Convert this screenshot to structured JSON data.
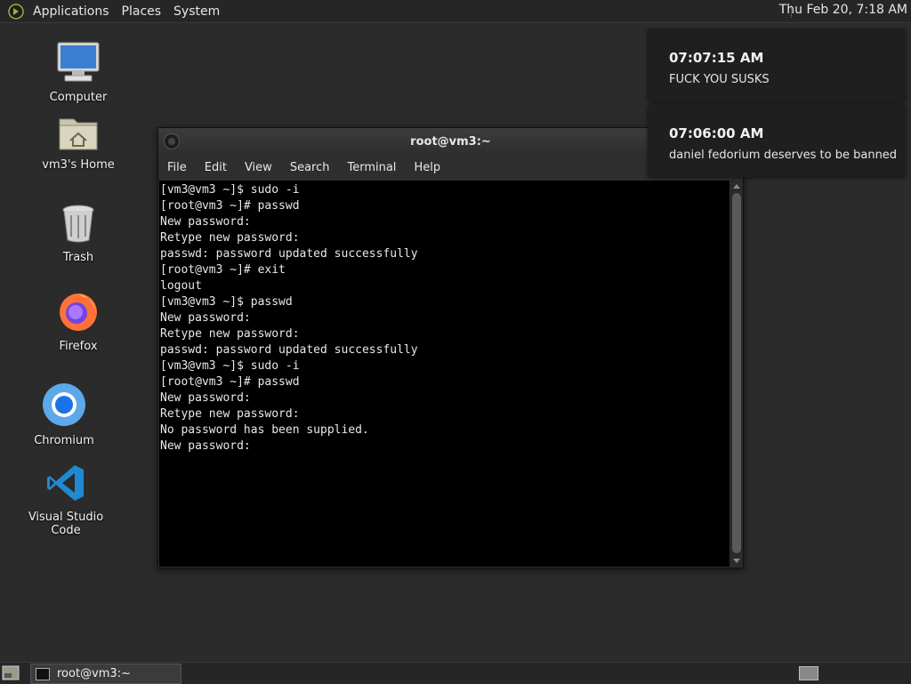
{
  "top_panel": {
    "menus": [
      "Applications",
      "Places",
      "System"
    ],
    "clock": "Thu Feb 20,  7:18 AM"
  },
  "desktop_icons": [
    {
      "label": "Computer",
      "icon": "computer-icon"
    },
    {
      "label": "vm3's Home",
      "icon": "home-folder-icon"
    },
    {
      "label": "Trash",
      "icon": "trash-icon"
    },
    {
      "label": "Firefox",
      "icon": "firefox-icon"
    },
    {
      "label": "Chromium",
      "icon": "chromium-icon"
    },
    {
      "label": "Visual Studio Code",
      "icon": "vscode-icon"
    }
  ],
  "terminal": {
    "title": "root@vm3:~",
    "menu": [
      "File",
      "Edit",
      "View",
      "Search",
      "Terminal",
      "Help"
    ],
    "lines": [
      "[vm3@vm3 ~]$ sudo -i",
      "[root@vm3 ~]# passwd",
      "New password:",
      "Retype new password:",
      "passwd: password updated successfully",
      "[root@vm3 ~]# exit",
      "logout",
      "[vm3@vm3 ~]$ passwd",
      "New password:",
      "Retype new password:",
      "passwd: password updated successfully",
      "[vm3@vm3 ~]$ sudo -i",
      "[root@vm3 ~]# passwd",
      "New password:",
      "Retype new password:",
      "No password has been supplied.",
      "New password:"
    ]
  },
  "notifications": [
    {
      "time": "07:07:15 AM",
      "message": "FUCK YOU SUSKS"
    },
    {
      "time": "07:06:00 AM",
      "message": "daniel fedorium deserves to be banned"
    }
  ],
  "bottom_panel": {
    "task_label": "root@vm3:~"
  },
  "colors": {
    "desktop": "#2b2b2b",
    "panel": "#262626",
    "terminal_bg": "#000000",
    "notification_bg": "#1f1f1f"
  }
}
